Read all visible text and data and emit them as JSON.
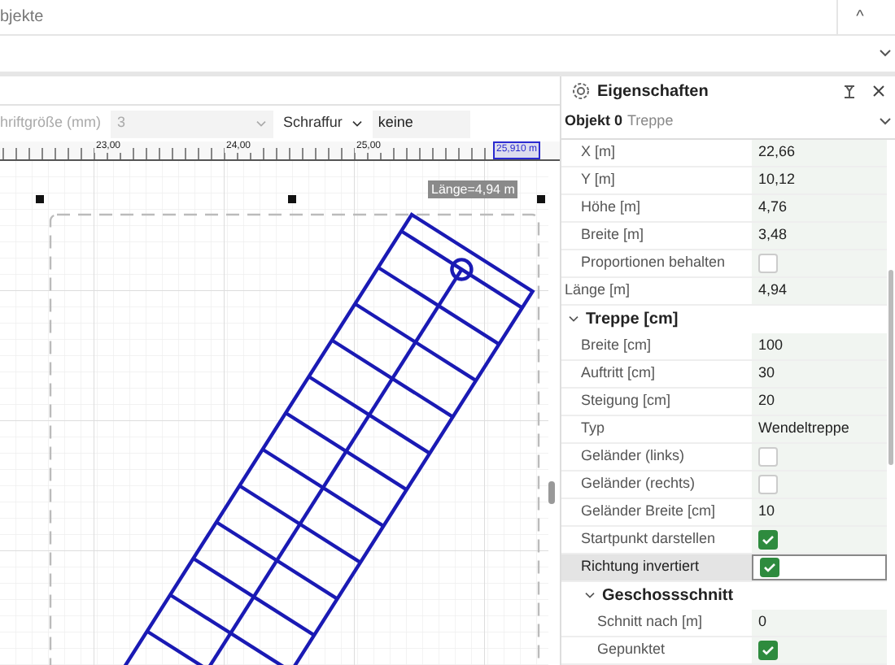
{
  "top_panel": {
    "title": "bjekte",
    "collapse_icon": "^"
  },
  "toolbar": {
    "font_size_label": "hriftgröße (mm)",
    "font_size_value": "3",
    "hatch_label": "Schraffur",
    "hatch_value": "keine"
  },
  "ruler": {
    "labels": [
      "23,00",
      "24,00",
      "25,00"
    ],
    "position": "25,910 m"
  },
  "canvas": {
    "length_label": "Länge=4,94 m"
  },
  "properties": {
    "title": "Eigenschaften",
    "object_label": "Objekt 0",
    "object_type": "Treppe",
    "items": [
      {
        "kind": "list",
        "children": [
          {
            "kind": "text",
            "label": "X [m]",
            "value": "22,66",
            "selected": false
          },
          {
            "kind": "text",
            "label": "Y [m]",
            "value": "10,12",
            "selected": false
          },
          {
            "kind": "text",
            "label": "Höhe [m]",
            "value": "4,76",
            "selected": false
          },
          {
            "kind": "text",
            "label": "Breite [m]",
            "value": "3,48",
            "selected": false
          },
          {
            "kind": "check",
            "label": "Proportionen behalten",
            "checked": false,
            "selected": false
          }
        ]
      },
      {
        "kind": "text",
        "label": "Länge [m]",
        "value": "4,94",
        "selected": false
      },
      {
        "kind": "group",
        "label": "Treppe [cm]",
        "expanded": true,
        "children": [
          {
            "kind": "text",
            "label": "Breite [cm]",
            "value": "100",
            "selected": false
          },
          {
            "kind": "text",
            "label": "Auftritt [cm]",
            "value": "30",
            "selected": false
          },
          {
            "kind": "text",
            "label": "Steigung [cm]",
            "value": "20",
            "selected": false
          },
          {
            "kind": "text",
            "label": "Typ",
            "value": "Wendeltreppe",
            "selected": false
          },
          {
            "kind": "check",
            "label": "Geländer (links)",
            "checked": false,
            "selected": false
          },
          {
            "kind": "check",
            "label": "Geländer (rechts)",
            "checked": false,
            "selected": false
          },
          {
            "kind": "text",
            "label": "Geländer Breite [cm]",
            "value": "10",
            "selected": false
          },
          {
            "kind": "check",
            "label": "Startpunkt darstellen",
            "checked": true,
            "selected": false
          },
          {
            "kind": "check",
            "label": "Richtung invertiert",
            "checked": true,
            "selected": true
          },
          {
            "kind": "group",
            "label": "Geschossschnitt",
            "expanded": true,
            "children": [
              {
                "kind": "text",
                "label": "Schnitt nach [m]",
                "value": "0",
                "selected": false
              },
              {
                "kind": "check",
                "label": "Gepunktet",
                "checked": true,
                "selected": false
              }
            ]
          }
        ]
      }
    ]
  }
}
